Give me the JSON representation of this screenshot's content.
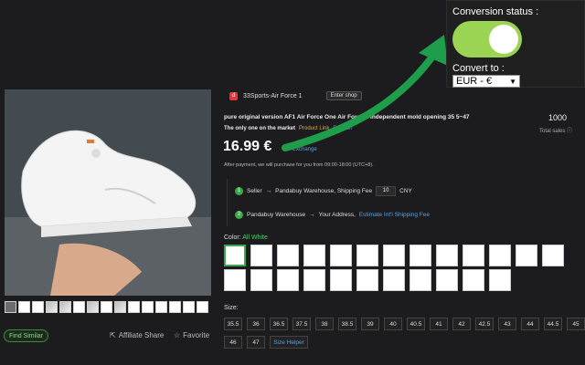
{
  "popup": {
    "status_label": "Conversion status :",
    "toggle_on": true,
    "convert_label": "Convert to :",
    "currency_selected": "EUR - €"
  },
  "colors": {
    "toggle_on": "#9bd452",
    "arrow": "#1e9e4a",
    "accent_green": "#3aaa4a",
    "link_blue": "#5aa0e0"
  },
  "shop": {
    "name": "33Sports-Air Force 1",
    "enter_label": "Enter shop",
    "icon": "shop-icon"
  },
  "product": {
    "title": "pure original version AF1 Air Force One Air Force 1 Independent mold opening 35 5~47",
    "subtitle": "The only one on the market",
    "product_link": "Product Link",
    "refresh": "Refresh",
    "sales_count": "1000",
    "sales_label": "Total sales",
    "price": "16.99 €",
    "exchange_label": "Exchange",
    "after_payment": "After payment, we will purchase for you from 09:00-18:00 (UTC+8)."
  },
  "shipping": {
    "step1_num": "1",
    "step1_from": "Seller",
    "step1_to": "Pandabuy Warehouse, Shipping Fee",
    "fee_value": "10",
    "fee_currency": "CNY",
    "step2_num": "2",
    "step2_from": "Pandabuy Warehouse",
    "step2_to": "Your Address,",
    "estimate_link": "Estimate Int'l Shipping Fee"
  },
  "color": {
    "label": "Color:",
    "selected": "All White"
  },
  "size": {
    "label": "Size:",
    "options": [
      "35.5",
      "36",
      "36.5",
      "37.5",
      "38",
      "38.5",
      "39",
      "40",
      "40.5",
      "41",
      "42",
      "42.5",
      "43",
      "44",
      "44.5",
      "45",
      "46",
      "47"
    ],
    "helper": "Size Helper"
  },
  "actions": {
    "find_similar": "Find Similar",
    "affiliate_share": "Affiliate Share",
    "favorite": "Favorite"
  }
}
